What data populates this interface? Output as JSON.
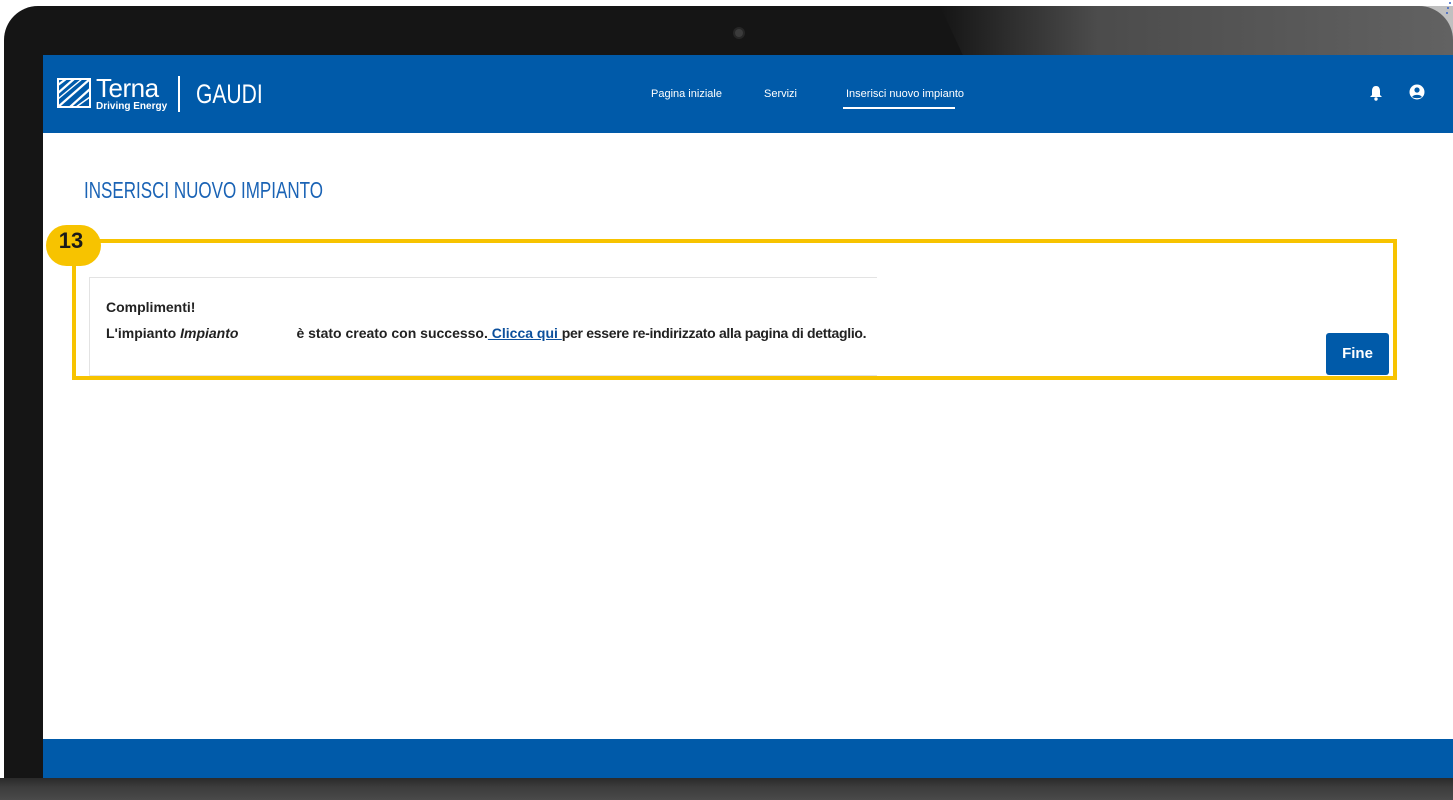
{
  "header": {
    "logo_text": "Terna",
    "logo_tagline": "Driving Energy",
    "app_name": "GAUDI",
    "nav": [
      {
        "label": "Pagina iniziale"
      },
      {
        "label": "Servizi"
      },
      {
        "label": "Inserisci nuovo impianto",
        "active": true
      }
    ],
    "icons": [
      "bell-icon",
      "user-icon"
    ]
  },
  "page": {
    "title": "INSERISCI NUOVO IMPIANTO"
  },
  "callout": {
    "number": "13",
    "color": "#f7c300"
  },
  "message": {
    "heading": "Complimenti!",
    "prefix": "L'impianto ",
    "plant_label": "Impianto",
    "middle": "è stato creato con successo.",
    "link_text": " Clicca qui ",
    "suffix": "per essere re-indirizzato alla pagina di dettaglio."
  },
  "actions": {
    "finish_label": "Fine"
  },
  "colors": {
    "brand_blue": "#005aa9",
    "title_blue": "#1a63b5",
    "link_blue": "#0b4f9c",
    "highlight": "#f7c300"
  }
}
